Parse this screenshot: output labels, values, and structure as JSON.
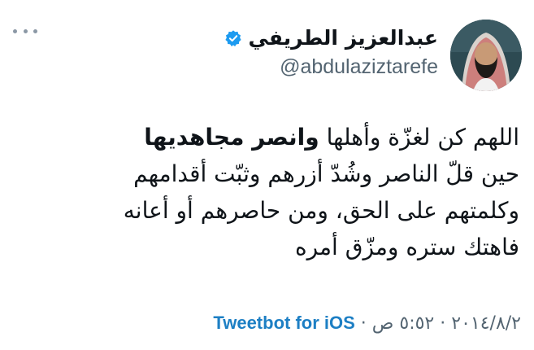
{
  "header": {
    "display_name": "عبدالعزيز الطريفي",
    "handle": "@abdulaziztarefe",
    "verified": true,
    "more_icon": "more-horizontal-icon",
    "verified_icon": "verified-badge-icon",
    "accent_color": "#1d9bf0"
  },
  "tweet": {
    "lines": [
      {
        "bold": "وانصر مجاهديها",
        "text": "اللهم كن لغزّة وأهلها"
      },
      {
        "text": "حين قلّ الناصر وشُدّ أزرهم وثبّت أقدامهم"
      },
      {
        "text": "وكلمتهم على الحق، ومن حاصرهم أو أعانه"
      },
      {
        "text": "فاهتك ستره ومزّق أمره"
      }
    ]
  },
  "meta": {
    "date": "٢٠١٤/٨/٢",
    "time": "٥:٥٢ ص",
    "separator": "·",
    "source": "Tweetbot for iOS",
    "source_color": "#1d7fc4"
  }
}
